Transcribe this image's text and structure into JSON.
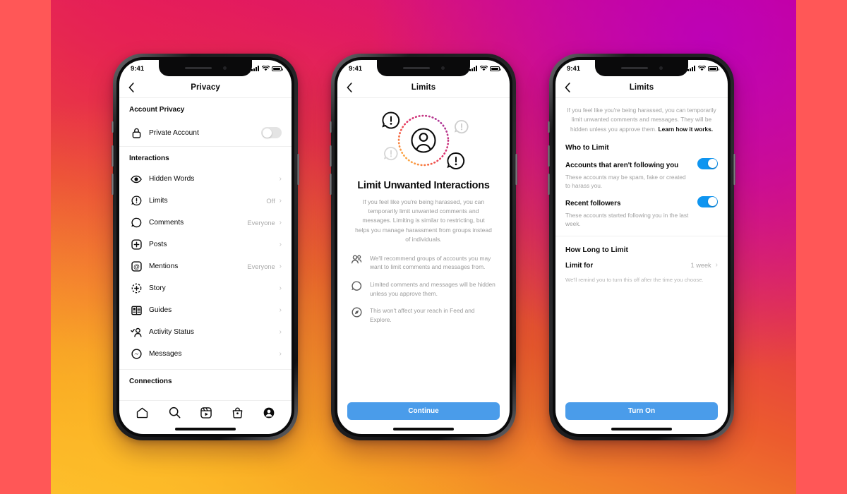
{
  "background": {
    "border_color": "#FF5757",
    "gradient_from": "#D6007F",
    "gradient_via": "#E63A45",
    "gradient_to": "#FBC02D",
    "accent_purple": "#B900BE"
  },
  "theme": {
    "blue": "#4A9CEA",
    "toggle_on": "#0F95F0",
    "toggle_off": "#E4E4E4",
    "text_primary": "#0A0A0A",
    "text_muted": "#9A9A9A"
  },
  "status_bar": {
    "time": "9:41",
    "signal": "signal-bars-icon",
    "wifi": "wifi-icon",
    "battery": "battery-icon"
  },
  "phone1": {
    "nav": {
      "back": "chevron-left-icon",
      "title": "Privacy"
    },
    "sections": [
      {
        "header": "Account Privacy",
        "rows": [
          {
            "icon": "lock-icon",
            "label": "Private Account",
            "control": "toggle",
            "toggle_on": false
          }
        ]
      },
      {
        "header": "Interactions",
        "rows": [
          {
            "icon": "eye-icon",
            "label": "Hidden Words",
            "value": "",
            "control": "chevron"
          },
          {
            "icon": "alert-bubble-icon",
            "label": "Limits",
            "value": "Off",
            "control": "chevron"
          },
          {
            "icon": "comment-bubble-icon",
            "label": "Comments",
            "value": "Everyone",
            "control": "chevron"
          },
          {
            "icon": "plus-square-icon",
            "label": "Posts",
            "value": "",
            "control": "chevron"
          },
          {
            "icon": "at-mention-icon",
            "label": "Mentions",
            "value": "Everyone",
            "control": "chevron"
          },
          {
            "icon": "story-plus-icon",
            "label": "Story",
            "value": "",
            "control": "chevron"
          },
          {
            "icon": "guides-book-icon",
            "label": "Guides",
            "value": "",
            "control": "chevron"
          },
          {
            "icon": "activity-status-icon",
            "label": "Activity Status",
            "value": "",
            "control": "chevron"
          },
          {
            "icon": "messenger-icon",
            "label": "Messages",
            "value": "",
            "control": "chevron"
          }
        ]
      },
      {
        "header": "Connections",
        "rows": []
      }
    ],
    "tabbar": [
      {
        "icon": "home-icon",
        "name": "tab-home"
      },
      {
        "icon": "search-icon",
        "name": "tab-search"
      },
      {
        "icon": "reels-icon",
        "name": "tab-reels"
      },
      {
        "icon": "shop-bag-icon",
        "name": "tab-shop"
      },
      {
        "icon": "profile-avatar-icon",
        "name": "tab-profile"
      }
    ]
  },
  "phone2": {
    "nav": {
      "back": "chevron-left-icon",
      "title": "Limits"
    },
    "illustration": {
      "center_icon": "person-circle-icon",
      "ring": "dotted-gradient-ring",
      "badges": [
        "alert-bubble-dark",
        "alert-bubble-faded",
        "alert-bubble-faded",
        "alert-bubble-dark"
      ]
    },
    "title": "Limit Unwanted Interactions",
    "description": "If you feel like you're being harassed, you can temporarily limit unwanted comments and messages. Limiting is similar to restricting, but helps you manage harassment from groups instead of individuals.",
    "bullets": [
      {
        "icon": "people-group-icon",
        "text": "We'll recommend groups of accounts you may want to limit comments and messages from."
      },
      {
        "icon": "comment-bubble-icon",
        "text": "Limited comments and messages will be hidden unless you approve them."
      },
      {
        "icon": "compass-explore-icon",
        "text": "This won't affect your reach in Feed and Explore."
      }
    ],
    "cta": "Continue"
  },
  "phone3": {
    "nav": {
      "back": "chevron-left-icon",
      "title": "Limits"
    },
    "intro": "If you feel like you're being harassed, you can temporarily limit unwanted comments and messages. They will be hidden unless you approve them. ",
    "intro_link": "Learn how it works.",
    "who_header": "Who to Limit",
    "switches": [
      {
        "title": "Accounts that aren't following you",
        "subtitle": "These accounts may be spam, fake or created to harass you.",
        "on": true
      },
      {
        "title": "Recent followers",
        "subtitle": "These accounts started following you in the last week.",
        "on": true
      }
    ],
    "how_long_header": "How Long to Limit",
    "limit_for": {
      "label": "Limit for",
      "value": "1 week",
      "control": "chevron"
    },
    "note": "We'll remind you to turn this off after the time you choose.",
    "cta": "Turn On"
  }
}
